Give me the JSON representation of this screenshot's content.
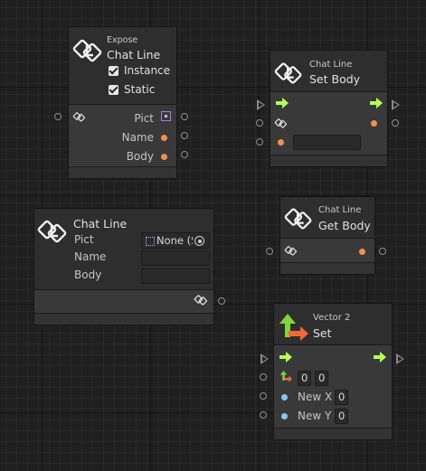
{
  "expose_node": {
    "subtitle": "Expose",
    "title": "Chat Line",
    "instance_label": "Instance",
    "static_label": "Static",
    "instance_checked": true,
    "static_checked": true,
    "ports": [
      "Pict",
      "Name",
      "Body"
    ]
  },
  "set_body_node": {
    "subtitle": "Chat Line",
    "title": "Set Body"
  },
  "chat_line_node": {
    "title": "Chat Line",
    "fields": [
      {
        "label": "Pict",
        "value": "None (S"
      },
      {
        "label": "Name",
        "value": ""
      },
      {
        "label": "Body",
        "value": ""
      }
    ]
  },
  "get_body_node": {
    "subtitle": "Chat Line",
    "title": "Get Body"
  },
  "vector2_node": {
    "subtitle": "Vector 2",
    "title": "Set",
    "vector_x": "0",
    "vector_y": "0",
    "new_x_label": "New X",
    "new_x_value": "0",
    "new_y_label": "New Y",
    "new_y_value": "0"
  },
  "icons": [
    "unity-logo-icon",
    "flow-arrow-icon",
    "object-field-picker-icon",
    "vector2-icon"
  ],
  "colors": {
    "flow_green": "#b4ff5a",
    "port_orange": "#f0914f",
    "port_blue": "#87c6ef",
    "node_bg": "#393939",
    "header_bg": "#2e2e2e"
  }
}
